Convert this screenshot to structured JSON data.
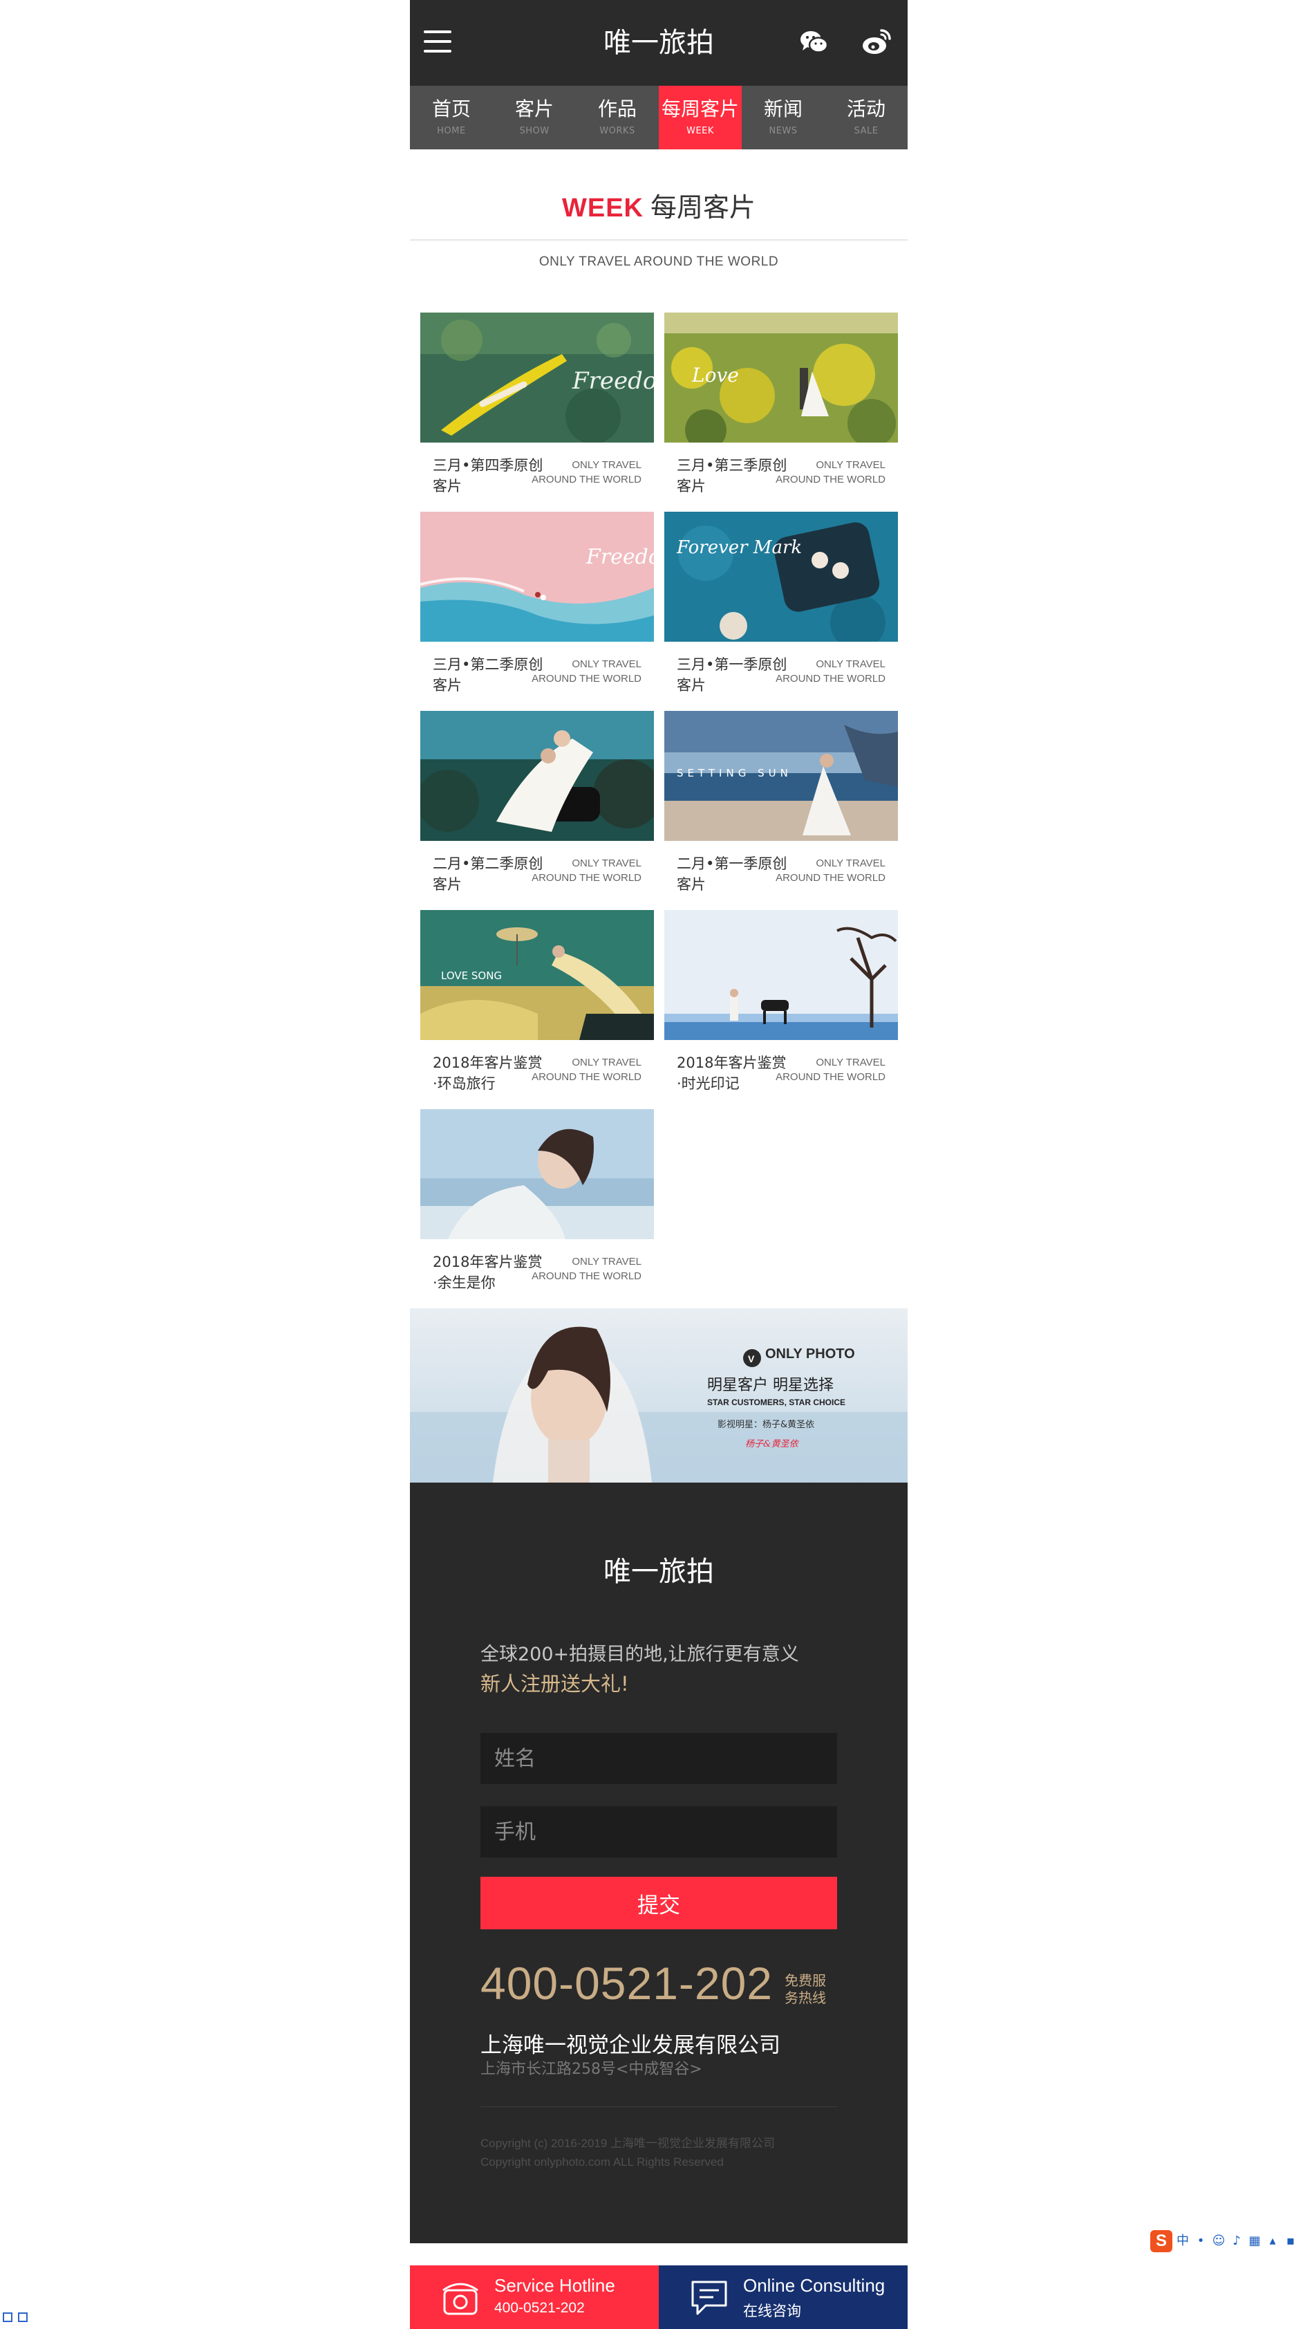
{
  "header": {
    "title": "唯一旅拍",
    "icons": [
      "menu-icon",
      "wechat-icon",
      "weibo-icon"
    ]
  },
  "nav": [
    {
      "cn": "首页",
      "en": "HOME"
    },
    {
      "cn": "客片",
      "en": "SHOW"
    },
    {
      "cn": "作品",
      "en": "WORKS"
    },
    {
      "cn": "每周客片",
      "en": "WEEK"
    },
    {
      "cn": "新闻",
      "en": "NEWS"
    },
    {
      "cn": "活动",
      "en": "SALE"
    }
  ],
  "active_nav": "每周客片",
  "section": {
    "title_en": "WEEK",
    "title_cn": "每周客片",
    "subtitle": "ONLY TRAVEL AROUND THE WORLD"
  },
  "cards": [
    {
      "caption": "三月•第四季原创客片",
      "en1": "ONLY TRAVEL",
      "en2": "AROUND THE WORLD",
      "image_text": "Freedom"
    },
    {
      "caption": "三月•第三季原创客片",
      "en1": "ONLY TRAVEL",
      "en2": "AROUND THE WORLD",
      "image_text": "Love"
    },
    {
      "caption": "三月•第二季原创客片",
      "en1": "ONLY TRAVEL",
      "en2": "AROUND THE WORLD",
      "image_text": "Freedom"
    },
    {
      "caption": "三月•第一季原创客片",
      "en1": "ONLY TRAVEL",
      "en2": "AROUND THE WORLD",
      "image_text": "Forever Mark"
    },
    {
      "caption": "二月•第二季原创客片",
      "en1": "ONLY TRAVEL",
      "en2": "AROUND THE WORLD",
      "image_text": ""
    },
    {
      "caption": "二月•第一季原创客片",
      "en1": "ONLY TRAVEL",
      "en2": "AROUND THE WORLD",
      "image_text": "SETTING SUN"
    },
    {
      "caption": "2018年客片鉴赏·环岛旅行",
      "en1": "ONLY TRAVEL",
      "en2": "AROUND THE WORLD",
      "image_text": "LOVE SONG"
    },
    {
      "caption": "2018年客片鉴赏·时光印记",
      "en1": "ONLY TRAVEL",
      "en2": "AROUND THE WORLD",
      "image_text": ""
    },
    {
      "caption": "2018年客片鉴赏·余生是你",
      "en1": "ONLY TRAVEL",
      "en2": "AROUND THE WORLD",
      "image_text": ""
    }
  ],
  "banner": {
    "brand": "ONLY PHOTO",
    "headline": "明星客户  明星选择",
    "headline_en": "STAR CUSTOMERS, STAR CHOICE",
    "note": "影视明星：杨子&黄圣依",
    "signature": "杨子&黄圣依"
  },
  "footer": {
    "title": "唯一旅拍",
    "slogan": "全球200+拍摄目的地,让旅行更有意义",
    "gift": "新人注册送大礼!",
    "name_placeholder": "姓名",
    "phone_placeholder": "手机",
    "submit": "提交",
    "hotline": "400-0521-202",
    "hotline_note_1": "免费服",
    "hotline_note_2": "务热线",
    "company": "上海唯一视觉企业发展有限公司",
    "address": "上海市长江路258号<中成智谷>",
    "copyright_1": "Copyright (c) 2016-2019 上海唯一视觉企业发展有限公司",
    "copyright_2": "Copyright onlyphoto.com ALL Rights Reserved"
  },
  "bottom_bar": {
    "hotline_label": "Service Hotline",
    "hotline_number": "400-0521-202",
    "consult_label": "Online Consulting",
    "consult_cn": "在线咨询"
  },
  "ime": {
    "logo": "S",
    "mode": "中"
  },
  "colors": {
    "accent": "#ff2d3f",
    "dark": "#2b2b2b",
    "nav": "#4f4f4f",
    "gold": "#c9ad86",
    "navy": "#16306f"
  }
}
